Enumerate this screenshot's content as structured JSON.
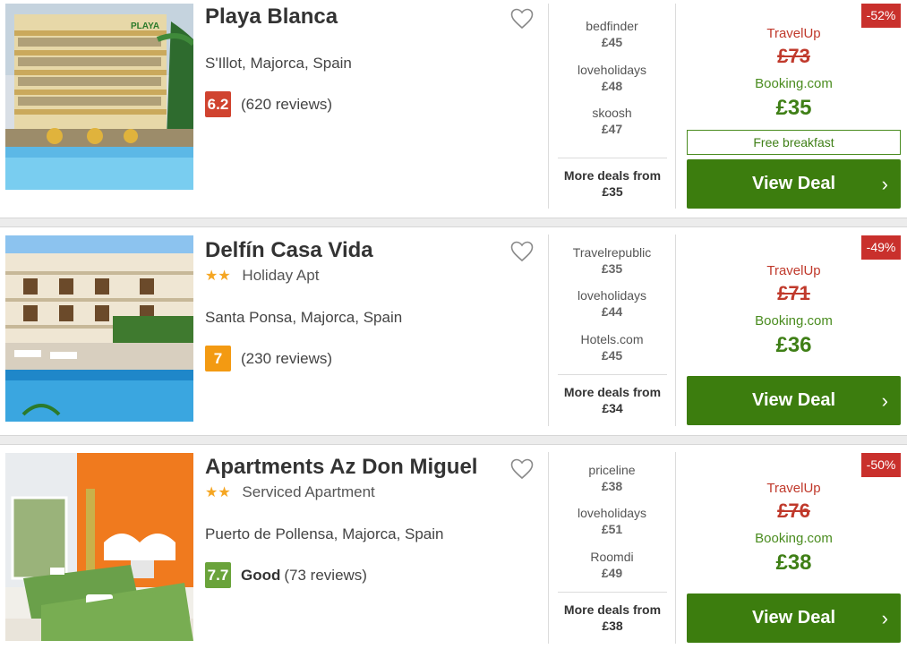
{
  "hotels": [
    {
      "name": "Playa Blanca",
      "stars": "",
      "type": "",
      "location": "S'Illot, Majorca, Spain",
      "score": "6.2",
      "rating_word": "",
      "reviews": "(620 reviews)",
      "score_color": "red",
      "deals": [
        {
          "site": "bedfinder",
          "price": "£45"
        },
        {
          "site": "loveholidays",
          "price": "£48"
        },
        {
          "site": "skoosh",
          "price": "£47"
        }
      ],
      "more_label": "More deals from",
      "more_price": "£35",
      "discount": "-52%",
      "was_site": "TravelUp",
      "was_price": "£73",
      "best_site": "Booking.com",
      "best_price": "£35",
      "perk": "Free breakfast",
      "button": "View Deal"
    },
    {
      "name": "Delfín Casa Vida",
      "stars": "★★",
      "type": "Holiday Apt",
      "location": "Santa Ponsa, Majorca, Spain",
      "score": "7",
      "rating_word": "",
      "reviews": "(230 reviews)",
      "score_color": "orange",
      "deals": [
        {
          "site": "Travelrepublic",
          "price": "£35"
        },
        {
          "site": "loveholidays",
          "price": "£44"
        },
        {
          "site": "Hotels.com",
          "price": "£45"
        }
      ],
      "more_label": "More deals from",
      "more_price": "£34",
      "discount": "-49%",
      "was_site": "TravelUp",
      "was_price": "£71",
      "best_site": "Booking.com",
      "best_price": "£36",
      "perk": "",
      "button": "View Deal"
    },
    {
      "name": "Apartments Az Don Miguel",
      "stars": "★★",
      "type": "Serviced Apartment",
      "location": "Puerto de Pollensa, Majorca, Spain",
      "score": "7.7",
      "rating_word": "Good",
      "reviews": "(73 reviews)",
      "score_color": "green",
      "deals": [
        {
          "site": "priceline",
          "price": "£38"
        },
        {
          "site": "loveholidays",
          "price": "£51"
        },
        {
          "site": "Roomdi",
          "price": "£49"
        }
      ],
      "more_label": "More deals from",
      "more_price": "£38",
      "discount": "-50%",
      "was_site": "TravelUp",
      "was_price": "£76",
      "best_site": "Booking.com",
      "best_price": "£38",
      "perk": "",
      "button": "View Deal"
    }
  ],
  "icons": {
    "favorite": "heart-outline-icon",
    "button_chevron": "chevron-right-icon",
    "star": "star-icon"
  },
  "colors": {
    "deal_button": "#3c7d0e",
    "discount_badge": "#c9302c",
    "was_price": "#c0392b",
    "best_price": "#3f7f16",
    "star": "#f5a623"
  }
}
